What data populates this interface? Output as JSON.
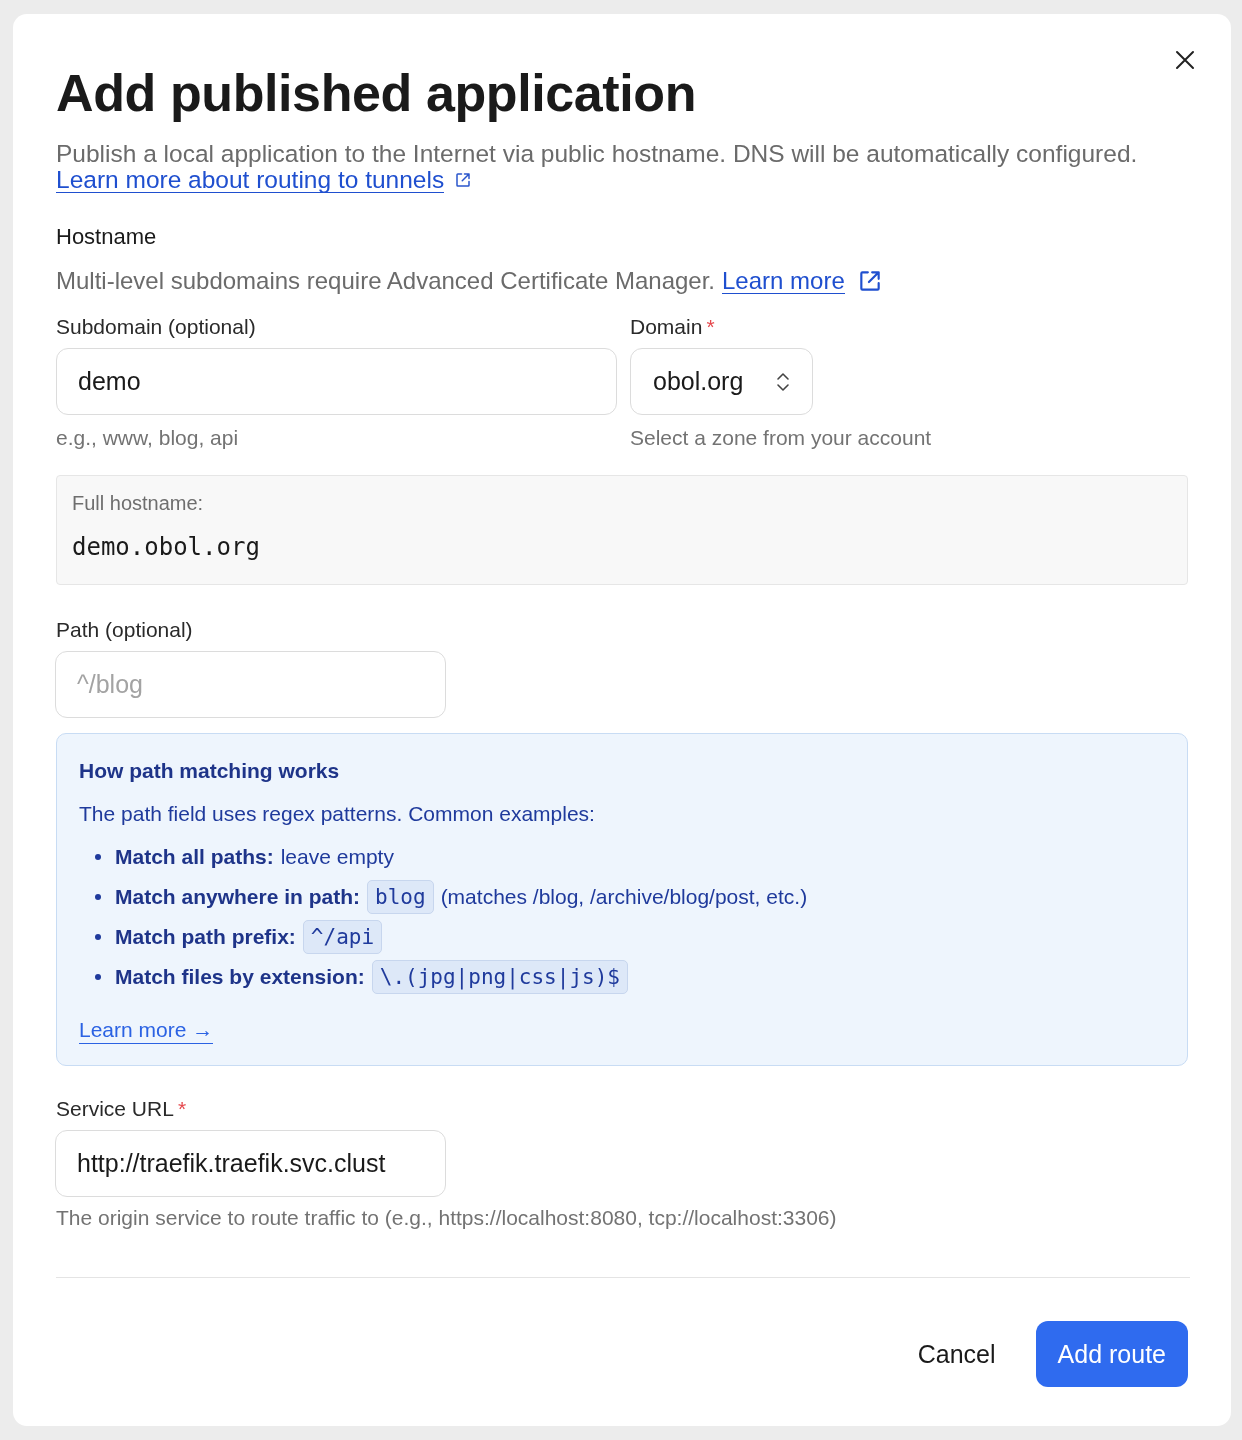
{
  "dialog": {
    "title": "Add published application",
    "description": "Publish a local application to the Internet via public hostname. DNS will be automatically configured.",
    "doc_link": "Learn more about routing to tunnels"
  },
  "hostname": {
    "heading": "Hostname",
    "note": "Multi-level subdomains require Advanced Certificate Manager.",
    "note_link": "Learn more",
    "subdomain": {
      "label": "Subdomain (optional)",
      "value": "demo",
      "hint": "e.g., www, blog, api"
    },
    "domain": {
      "label": "Domain",
      "required_mark": "*",
      "value": "obol.org",
      "hint": "Select a zone from your account"
    },
    "full_hostname": {
      "label": "Full hostname:",
      "value": "demo.obol.org"
    }
  },
  "path": {
    "label": "Path (optional)",
    "placeholder": "^/blog"
  },
  "path_help": {
    "title": "How path matching works",
    "intro": "The path field uses regex patterns. Common examples:",
    "examples": [
      {
        "label": "Match all paths:",
        "text": "leave empty"
      },
      {
        "label": "Match anywhere in path:",
        "code": "blog",
        "text": "(matches /blog, /archive/blog/post, etc.)"
      },
      {
        "label": "Match path prefix:",
        "code": "^/api"
      },
      {
        "label": "Match files by extension:",
        "code": "\\.(jpg|png|css|js)$"
      }
    ],
    "link": "Learn more →"
  },
  "service_url": {
    "label": "Service URL",
    "required_mark": "*",
    "value": "http://traefik.traefik.svc.clust",
    "hint": "The origin service to route traffic to (e.g., https://localhost:8080, tcp://localhost:3306)"
  },
  "buttons": [
    {
      "label": "Cancel",
      "kind": "secondary"
    },
    {
      "label": "Add route",
      "kind": "primary"
    }
  ]
}
